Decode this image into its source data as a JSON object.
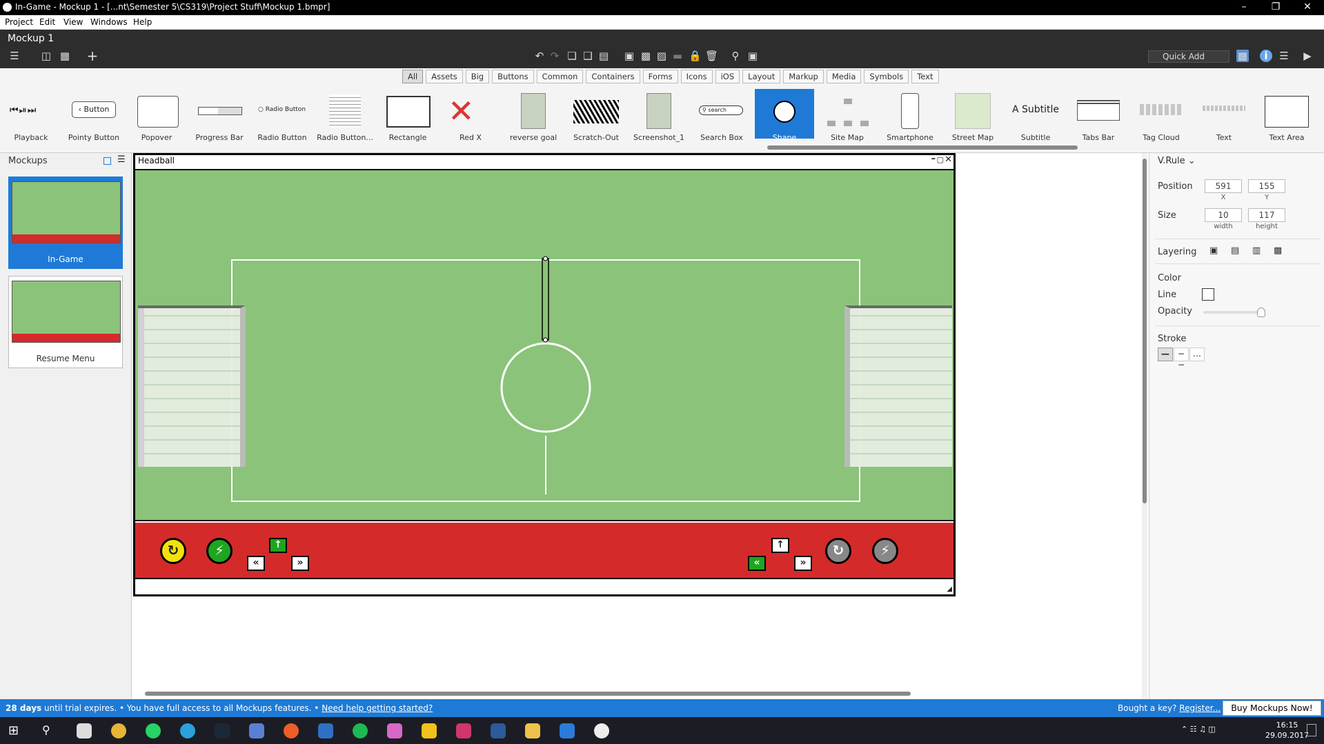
{
  "window": {
    "title": "In-Game - Mockup 1 - [...nt\\Semester 5\\CS319\\Project Stuff\\Mockup 1.bmpr]"
  },
  "menu": [
    "Project",
    "Edit",
    "View",
    "Windows",
    "Help"
  ],
  "toolbar": {
    "mockup_name": "Mockup 1",
    "quick_add_placeholder": "Quick Add"
  },
  "library": {
    "filters": [
      "All",
      "Assets",
      "Big",
      "Buttons",
      "Common",
      "Containers",
      "Forms",
      "Icons",
      "iOS",
      "Layout",
      "Markup",
      "Media",
      "Symbols",
      "Text"
    ],
    "active_filter": "All",
    "items": [
      "Playback",
      "Pointy Button",
      "Popover",
      "Progress Bar",
      "Radio Button",
      "Radio Button...",
      "Rectangle",
      "Red X",
      "reverse goal",
      "Scratch-Out",
      "Screenshot_1",
      "Search Box",
      "Shape",
      "Site Map",
      "Smartphone",
      "Street Map",
      "Subtitle",
      "Tabs Bar",
      "Tag Cloud",
      "Text",
      "Text Area"
    ],
    "selected": "Shape",
    "inline": {
      "button": "Button",
      "radio": "Radio Button",
      "search": "search",
      "subtitle": "A Subtitle"
    }
  },
  "mockups": {
    "header": "Mockups",
    "items": [
      "In-Game",
      "Resume Menu"
    ],
    "selected": "In-Game"
  },
  "mockup_window": {
    "title": "Headball",
    "controls": [
      "–",
      "▢",
      "✕"
    ]
  },
  "game": {
    "field_color": "#8bc37a",
    "bar_color": "#d52a2a",
    "left_buttons": {
      "yellow": "↻",
      "green": "⚡",
      "up": "↑",
      "left": "«",
      "right": "»"
    },
    "right_buttons": {
      "up": "↑",
      "left": "«",
      "right": "»",
      "gray1": "↻",
      "gray2": "⚡"
    }
  },
  "properties": {
    "title": "V.Rule",
    "position_label": "Position",
    "x": "591",
    "y": "155",
    "x_label": "X",
    "y_label": "Y",
    "size_label": "Size",
    "width": "10",
    "height": "117",
    "width_label": "width",
    "height_label": "height",
    "layering_label": "Layering",
    "color_label": "Color",
    "line_label": "Line",
    "opacity_label": "Opacity",
    "stroke_label": "Stroke"
  },
  "status": {
    "days": "28 days",
    "text": " until trial expires. • You have full access to all Mockups features. • ",
    "help_link": "Need help getting started?",
    "key_text": "Bought a key?",
    "register": "Register...",
    "buy": "Buy Mockups Now!"
  },
  "clock": {
    "time": "16:15",
    "date": "29.09.2017"
  }
}
